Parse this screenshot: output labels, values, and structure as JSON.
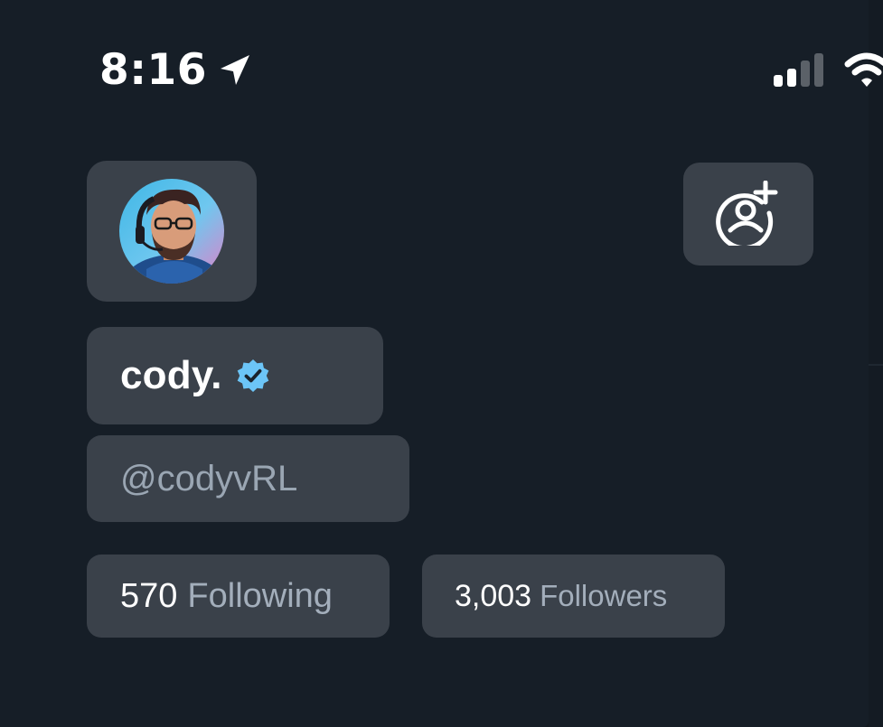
{
  "status_bar": {
    "time": "8:16",
    "location_icon": "location-arrow-icon",
    "signal_icon": "cellular-signal-icon",
    "wifi_icon": "wifi-icon"
  },
  "profile": {
    "name": "cody.",
    "verified_icon": "verified-badge-icon",
    "handle": "@codyvRL",
    "following_count": "570",
    "following_label": "Following",
    "followers_count": "3,003",
    "followers_label": "Followers",
    "follow_icon": "add-person-icon"
  },
  "colors": {
    "background": "#161e27",
    "card": "#3a414a",
    "verified": "#6cc5f7",
    "muted_text": "#9aa6b3"
  }
}
